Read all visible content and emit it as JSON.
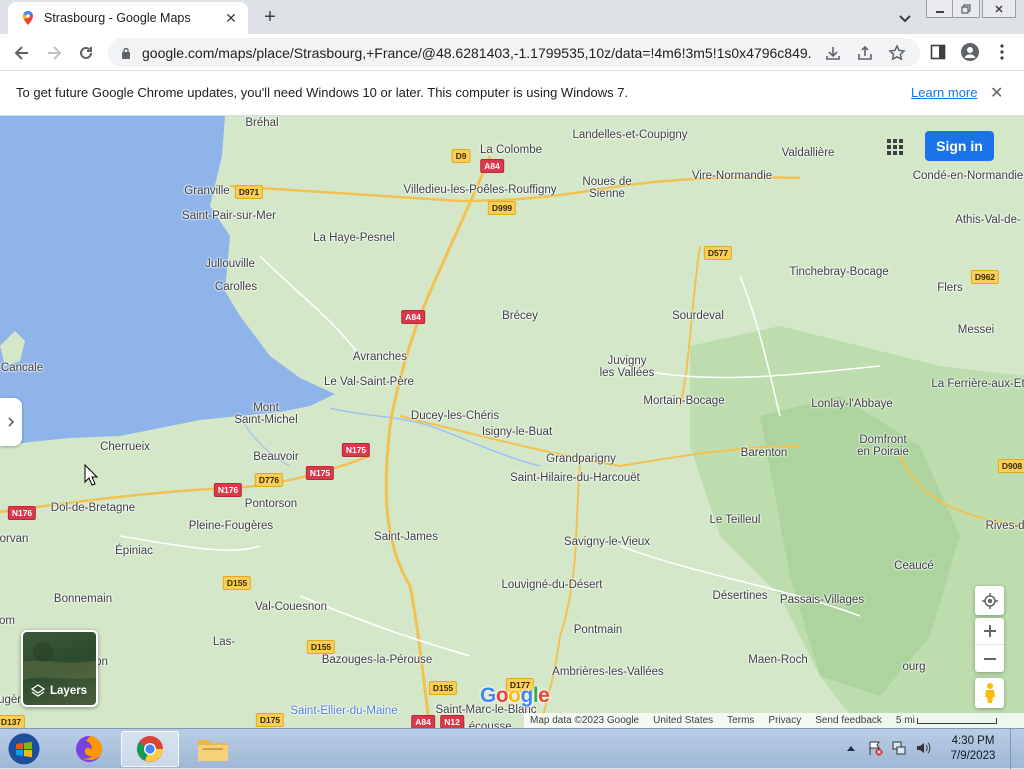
{
  "browser": {
    "tab_title": "Strasbourg - Google Maps",
    "url": "google.com/maps/place/Strasbourg,+France/@48.6281403,-1.1799535,10z/data=!4m6!3m5!1s0x4796c849...",
    "infobar_message": "To get future Google Chrome updates, you'll need Windows 10 or later. This computer is using Windows 7.",
    "infobar_link": "Learn more"
  },
  "map": {
    "signin_label": "Sign in",
    "layers_label": "Layers",
    "google_logo": "Google",
    "footer": {
      "map_data": "Map data ©2023 Google",
      "country": "United States",
      "terms": "Terms",
      "privacy": "Privacy",
      "feedback": "Send feedback",
      "scale": "5 mi"
    },
    "places": [
      {
        "name": "Bréhal"
      },
      {
        "name": "Landelles-et-Coupigny"
      },
      {
        "name": "La Colombe"
      },
      {
        "name": "Valdallière"
      },
      {
        "name": "Granville"
      },
      {
        "name": "Villedieu-les-Poêles-Rouffigny"
      },
      {
        "name": "Noues de Sienne"
      },
      {
        "name": "Vire-Normandie"
      },
      {
        "name": "Condé-en-Normandie"
      },
      {
        "name": "Saint-Pair-sur-Mer"
      },
      {
        "name": "Athis-Val-de-"
      },
      {
        "name": "La Haye-Pesnel"
      },
      {
        "name": "Jullouville"
      },
      {
        "name": "Tinchebray-Bocage"
      },
      {
        "name": "Carolles"
      },
      {
        "name": "Flers"
      },
      {
        "name": "Brécey"
      },
      {
        "name": "Sourdeval"
      },
      {
        "name": "Messei"
      },
      {
        "name": "Cancale"
      },
      {
        "name": "Avranches"
      },
      {
        "name": "Juvigny les Vallées"
      },
      {
        "name": "Le Val-Saint-Père"
      },
      {
        "name": "La Ferrière-aux-Et"
      },
      {
        "name": "Mortain-Bocage"
      },
      {
        "name": "Lonlay-l'Abbaye"
      },
      {
        "name": "Mont Saint-Michel"
      },
      {
        "name": "Ducey-les-Chéris"
      },
      {
        "name": "Isigny-le-Buat"
      },
      {
        "name": "Domfront en Poiraie"
      },
      {
        "name": "Cherrueix"
      },
      {
        "name": "Barenton"
      },
      {
        "name": "Grandparigny"
      },
      {
        "name": "Beauvoir"
      },
      {
        "name": "Saint-Hilaire-du-Harcouët"
      },
      {
        "name": "Dol-de-Bretagne"
      },
      {
        "name": "Pontorson"
      },
      {
        "name": "Le Teilleul"
      },
      {
        "name": "Rives-d'A"
      },
      {
        "name": "Pleine-Fougères"
      },
      {
        "name": "orvan"
      },
      {
        "name": "Saint-James"
      },
      {
        "name": "Savigny-le-Vieux"
      },
      {
        "name": "Épiniac"
      },
      {
        "name": "Ceaucé"
      },
      {
        "name": "Louvigné-du-Désert"
      },
      {
        "name": "Désertines"
      },
      {
        "name": "Bonnemain"
      },
      {
        "name": "Passais-Villages"
      },
      {
        "name": "Val-Couesnon"
      },
      {
        "name": "Pontmain"
      },
      {
        "name": "Las-"
      },
      {
        "name": "Bazouges-la-Pérouse"
      },
      {
        "name": "Maen-Roch"
      },
      {
        "name": "Gorron"
      },
      {
        "name": "ourg"
      },
      {
        "name": "Ambrières-les-Vallées"
      },
      {
        "name": "Saint-Ellier-du-Maine"
      },
      {
        "name": "Saint-Marc-le-Blanc"
      },
      {
        "name": "Lécousse"
      },
      {
        "name": "Fougères"
      },
      {
        "name": "om"
      },
      {
        "name": "c"
      }
    ],
    "shields": [
      {
        "label": "D9",
        "color": "yellow"
      },
      {
        "label": "A84",
        "color": "red"
      },
      {
        "label": "D971",
        "color": "yellow"
      },
      {
        "label": "D999",
        "color": "yellow"
      },
      {
        "label": "D577",
        "color": "yellow"
      },
      {
        "label": "D962",
        "color": "yellow"
      },
      {
        "label": "A84",
        "color": "red"
      },
      {
        "label": "N175",
        "color": "red"
      },
      {
        "label": "N175",
        "color": "red"
      },
      {
        "label": "D776",
        "color": "yellow"
      },
      {
        "label": "N176",
        "color": "red"
      },
      {
        "label": "N176",
        "color": "red"
      },
      {
        "label": "D908",
        "color": "yellow"
      },
      {
        "label": "D155",
        "color": "yellow"
      },
      {
        "label": "D155",
        "color": "yellow"
      },
      {
        "label": "D155",
        "color": "yellow"
      },
      {
        "label": "D177",
        "color": "yellow"
      },
      {
        "label": "D175",
        "color": "yellow"
      },
      {
        "label": "A84",
        "color": "red"
      },
      {
        "label": "N12",
        "color": "red"
      },
      {
        "label": "D137",
        "color": "yellow"
      }
    ]
  },
  "taskbar": {
    "time": "4:30 PM",
    "date": "7/9/2023"
  },
  "colors": {
    "accent": "#1a73e8",
    "land": "#d4e8c9",
    "forest": "#a9d29a",
    "water": "#8fb4ea"
  }
}
